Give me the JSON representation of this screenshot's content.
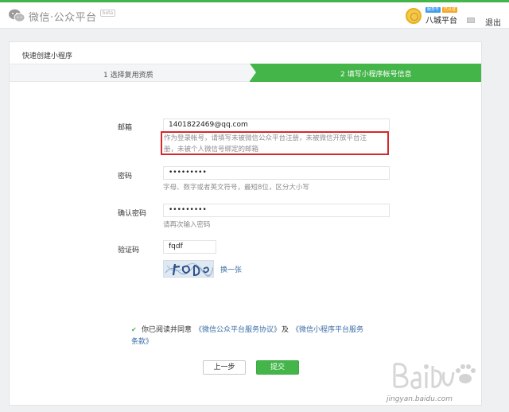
{
  "header": {
    "logo_text": "微信·公众平台",
    "beta_badge": "beta",
    "badge_left": "服务号",
    "badge_right": "已认证",
    "account_name": "八城平台",
    "logout_label": "退出"
  },
  "panel": {
    "title": "快速创建小程序",
    "steps": [
      {
        "label": "1 选择复用资质",
        "active": false
      },
      {
        "label": "2 填写小程序帐号信息",
        "active": true
      }
    ]
  },
  "form": {
    "email": {
      "label": "邮箱",
      "value": "1401822469@qq.com",
      "hint_line1": "作为登录帐号，请填写未被微信公众平台注册，未被微信开放平台注",
      "hint_line2": "册，未被个人微信号绑定的邮箱"
    },
    "password": {
      "label": "密码",
      "value": "•••••••••",
      "hint": "字母、数字或者英文符号，最短8位，区分大小写"
    },
    "confirm_password": {
      "label": "确认密码",
      "value": "•••••••••",
      "hint": "请再次输入密码"
    },
    "captcha": {
      "label": "验证码",
      "value": "fqdf",
      "change_link": "换一张"
    }
  },
  "agreement": {
    "checked": true,
    "prefix": "你已阅读并同意",
    "link1": "《微信公众平台服务协议》",
    "and": "及",
    "link2_part1": "《微信小程序平台服务",
    "link2_part2": "条款》"
  },
  "buttons": {
    "prev": "上一步",
    "submit": "提交"
  },
  "watermark": {
    "site": "jingyan.baidu.com"
  },
  "colors": {
    "accent_green": "#44b549",
    "link_blue": "#3b6ea5",
    "highlight_red": "#d9282b"
  }
}
